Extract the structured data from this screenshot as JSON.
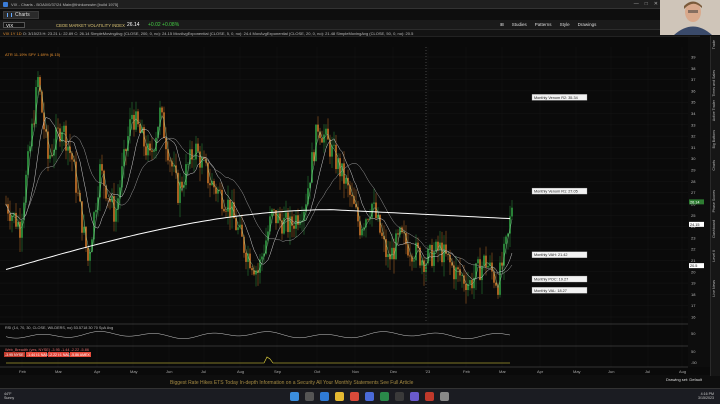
{
  "window": {
    "title": "VIX - Charts - BOA0/0/37/24 Main@thinkorswim [build 1975]",
    "controls": [
      "—",
      "□",
      "✕"
    ]
  },
  "charts_tab": {
    "label": "Charts",
    "icon": "bars-icon"
  },
  "symbol": {
    "input_value": "VIX",
    "name": "CBOE MARKET VOLATILITY INDEX",
    "last": "26.14",
    "change": "+0.02 +0.08%"
  },
  "toolbar": {
    "items": [
      "⊞",
      "Studies",
      "Patterns",
      "Style",
      "Drawings"
    ]
  },
  "study_bar": {
    "left": "VIX 1Y 1D",
    "detail": "O: 3/15/23  H: 23.21  L: 22.89  C: 26.14  SimpleMovingAvg (CLOSE, 200, 0, no): 24.15   MovAvgExponential (CLOSE, 5, 0, no): 24.4   MovAvgExponential (CLOSE, 20, 0, no): 21.48   SimpleMovingAvg (CLOSE, 50, 0, no): 20.5"
  },
  "atr_label": "ATR 11.19% SPY 1.69% (6.15)",
  "price_labels": [
    {
      "text": "Monthly Venom R2: 35.34",
      "price": 35.34
    },
    {
      "text": "Monthly Venom R1: 27.05",
      "price": 27.05
    },
    {
      "text": "Monthly VAH: 21.42",
      "price": 21.42
    },
    {
      "text": "Monthly POC: 19.27",
      "price": 19.27
    },
    {
      "text": "Monthly VAL: 18.27",
      "price": 18.27
    }
  ],
  "price_axis": [
    "39",
    "38",
    "37",
    "36",
    "35",
    "34",
    "33",
    "32",
    "31",
    "30",
    "29",
    "28",
    "27",
    "26",
    "25",
    "24",
    "23",
    "22",
    "21",
    "20",
    "19",
    "18",
    "17",
    "16"
  ],
  "price_tags": [
    {
      "text": "26.14",
      "color": "#2e7d32"
    },
    {
      "text": "24.15",
      "color": "#ffffff"
    },
    {
      "text": "20.5",
      "color": "#ffffff"
    }
  ],
  "x_axis": [
    "Feb",
    "Mar",
    "Apr",
    "May",
    "Jun",
    "Jul",
    "Aug",
    "Sep",
    "Oct",
    "Nov",
    "Dec",
    "'23",
    "Feb",
    "Mar",
    "Apr",
    "May",
    "Jun",
    "Jul",
    "Aug"
  ],
  "rsi_label": "RSI (14, 70, 30, CLOSE, WILDERS, no)  53.5718   30  70   SpA  Avg",
  "rsi_axis": [
    "50"
  ],
  "breadth_label": "Web_Breadth (yes, NYSE)  -3.95  -1.44  -2.22  -5.86",
  "breadth_values": [
    "-3.95 NYSE",
    "-1.44 I:1 NAS",
    "-2.22 I:1 NAQ",
    "-5.86 AMEX"
  ],
  "breadth_axis": [
    "50",
    "-50"
  ],
  "drawings_default": "Drawing set: Default",
  "sub_strip": "Biggest Rate Hikes   ETS   Today In-depth Information on a Security   All Your Monthly Statements   See Full Article",
  "rail": [
    "Trade",
    "Times and Sales",
    "Active Trader",
    "Big Buttons",
    "Charts",
    "Phase Scores",
    "Dashboard",
    "Level II",
    "Live News"
  ],
  "taskbar": {
    "weather": "44°F",
    "weather_desc": "Sunny",
    "time": "4:16 PM",
    "date": "3/15/2023"
  },
  "colors": {
    "up": "#35b24a",
    "down": "#e8862c",
    "ema5": "#8fd19e",
    "sma200": "#ffffff",
    "accent": "#d9c272"
  }
}
